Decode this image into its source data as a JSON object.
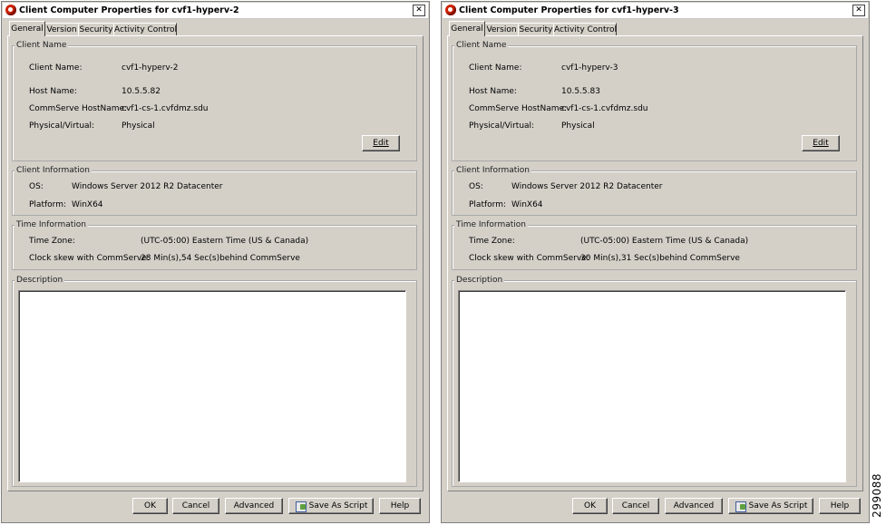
{
  "dialogs": [
    {
      "title": "Client Computer Properties for cvf1-hyperv-2",
      "tabs": [
        "General",
        "Version",
        "Security",
        "Activity Control"
      ],
      "client_name_group": {
        "legend": "Client Name",
        "client_name_label": "Client Name:",
        "client_name_value": "cvf1-hyperv-2",
        "host_name_label": "Host Name:",
        "host_name_value": "10.5.5.82",
        "commserve_label": "CommServe HostName:",
        "commserve_value": "cvf1-cs-1.cvfdmz.sdu",
        "physical_label": "Physical/Virtual:",
        "physical_value": "Physical",
        "edit_label": "Edit"
      },
      "client_info_group": {
        "legend": "Client Information",
        "os_label": "OS:",
        "os_value": "Windows Server 2012 R2 Datacenter",
        "platform_label": "Platform:",
        "platform_value": "WinX64"
      },
      "time_info_group": {
        "legend": "Time Information",
        "timezone_label": "Time Zone:",
        "timezone_value": "(UTC-05:00) Eastern Time (US & Canada)",
        "skew_label": "Clock skew with CommServe:",
        "skew_value": "28 Min(s),54 Sec(s)behind CommServe"
      },
      "description_group": {
        "legend": "Description",
        "value": ""
      },
      "buttons": {
        "ok": "OK",
        "cancel": "Cancel",
        "advanced": "Advanced",
        "save_script": "Save As Script",
        "help": "Help"
      }
    },
    {
      "title": "Client Computer Properties for cvf1-hyperv-3",
      "tabs": [
        "General",
        "Version",
        "Security",
        "Activity Control"
      ],
      "client_name_group": {
        "legend": "Client Name",
        "client_name_label": "Client Name:",
        "client_name_value": "cvf1-hyperv-3",
        "host_name_label": "Host Name:",
        "host_name_value": "10.5.5.83",
        "commserve_label": "CommServe HostName:",
        "commserve_value": "cvf1-cs-1.cvfdmz.sdu",
        "physical_label": "Physical/Virtual:",
        "physical_value": "Physical",
        "edit_label": "Edit"
      },
      "client_info_group": {
        "legend": "Client Information",
        "os_label": "OS:",
        "os_value": "Windows Server 2012 R2 Datacenter",
        "platform_label": "Platform:",
        "platform_value": "WinX64"
      },
      "time_info_group": {
        "legend": "Time Information",
        "timezone_label": "Time Zone:",
        "timezone_value": "(UTC-05:00) Eastern Time (US & Canada)",
        "skew_label": "Clock skew with CommServe:",
        "skew_value": "30 Min(s),31 Sec(s)behind CommServe"
      },
      "description_group": {
        "legend": "Description",
        "value": ""
      },
      "buttons": {
        "ok": "OK",
        "cancel": "Cancel",
        "advanced": "Advanced",
        "save_script": "Save As Script",
        "help": "Help"
      }
    }
  ],
  "figure_number": "299088"
}
